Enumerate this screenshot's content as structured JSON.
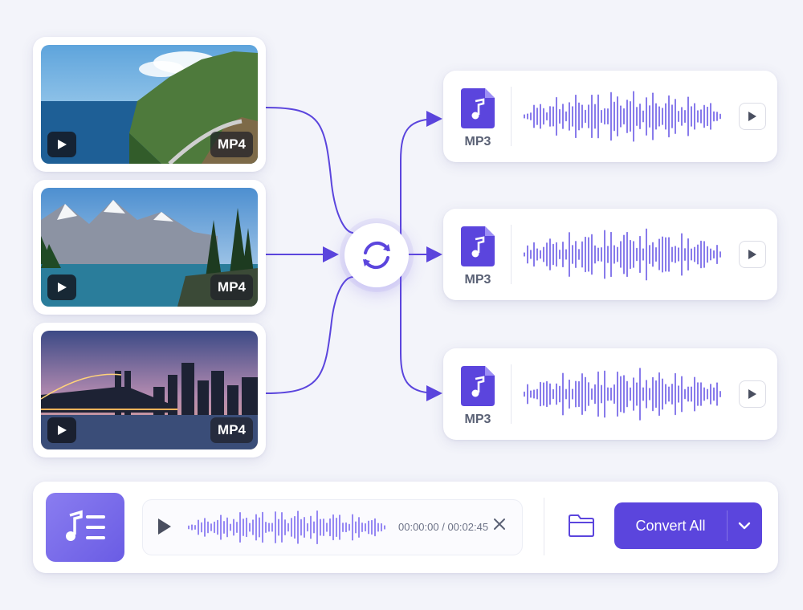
{
  "videos": [
    {
      "format": "MP4",
      "scene": "coastal road"
    },
    {
      "format": "MP4",
      "scene": "mountain lake"
    },
    {
      "format": "MP4",
      "scene": "city bridge at dusk"
    }
  ],
  "outputs": [
    {
      "format": "MP3"
    },
    {
      "format": "MP3"
    },
    {
      "format": "MP3"
    }
  ],
  "player": {
    "time": "00:00:00 / 00:02:45"
  },
  "actions": {
    "convert_label": "Convert All"
  },
  "icons": {
    "hub": "sync-icon",
    "file": "music-file-icon",
    "play": "play-icon",
    "folder": "folder-icon",
    "close": "close-icon",
    "caret": "chevron-down-icon",
    "playlist": "music-playlist-icon"
  },
  "colors": {
    "accent": "#5b45dd",
    "accent_light": "#7c6cf0",
    "background": "#f3f4fa"
  }
}
